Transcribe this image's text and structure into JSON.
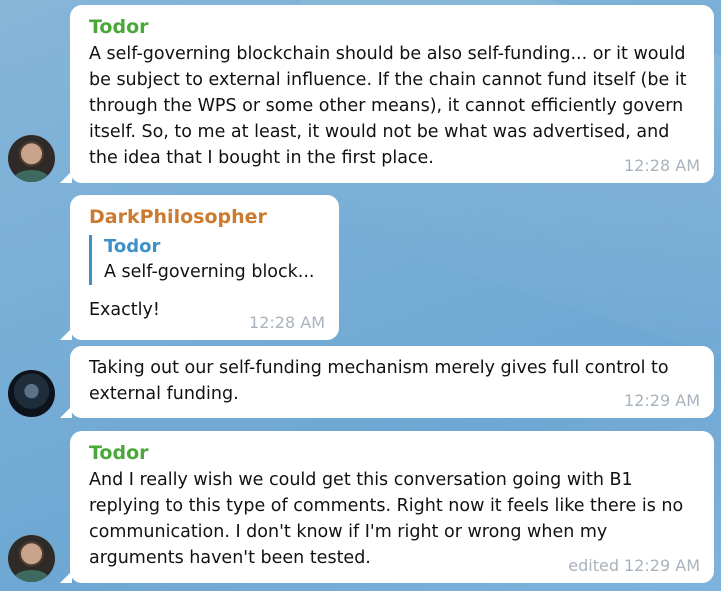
{
  "messages": [
    {
      "sender": "Todor",
      "text": "A self-governing blockchain should be also self-funding... or it would be subject to external influence. If the chain cannot fund itself (be it through the WPS or some other means), it cannot efficiently govern itself. So, to me at least, it would not be what was advertised, and the idea that I bought in the first place.",
      "time": "12:28 AM"
    },
    {
      "sender": "DarkPhilosopher",
      "quote_sender": "Todor",
      "quote_text": "A self-governing block...",
      "text": "Exactly!",
      "time": "12:28 AM"
    },
    {
      "text": "Taking out our self-funding mechanism merely gives full control to external funding.",
      "time": "12:29 AM"
    },
    {
      "sender": "Todor",
      "text": "And I really wish we could get this conversation going with B1 replying to this type of comments. Right now it feels like there is no communication. I don't know if I'm right or wrong when my arguments haven't been tested.",
      "time": "edited 12:29 AM"
    }
  ],
  "colors": {
    "todor_name": "#4aa83a",
    "darkphilosopher_name": "#cc7a30",
    "quote_accent": "#3d91c9",
    "timestamp": "#a9b3bd"
  }
}
